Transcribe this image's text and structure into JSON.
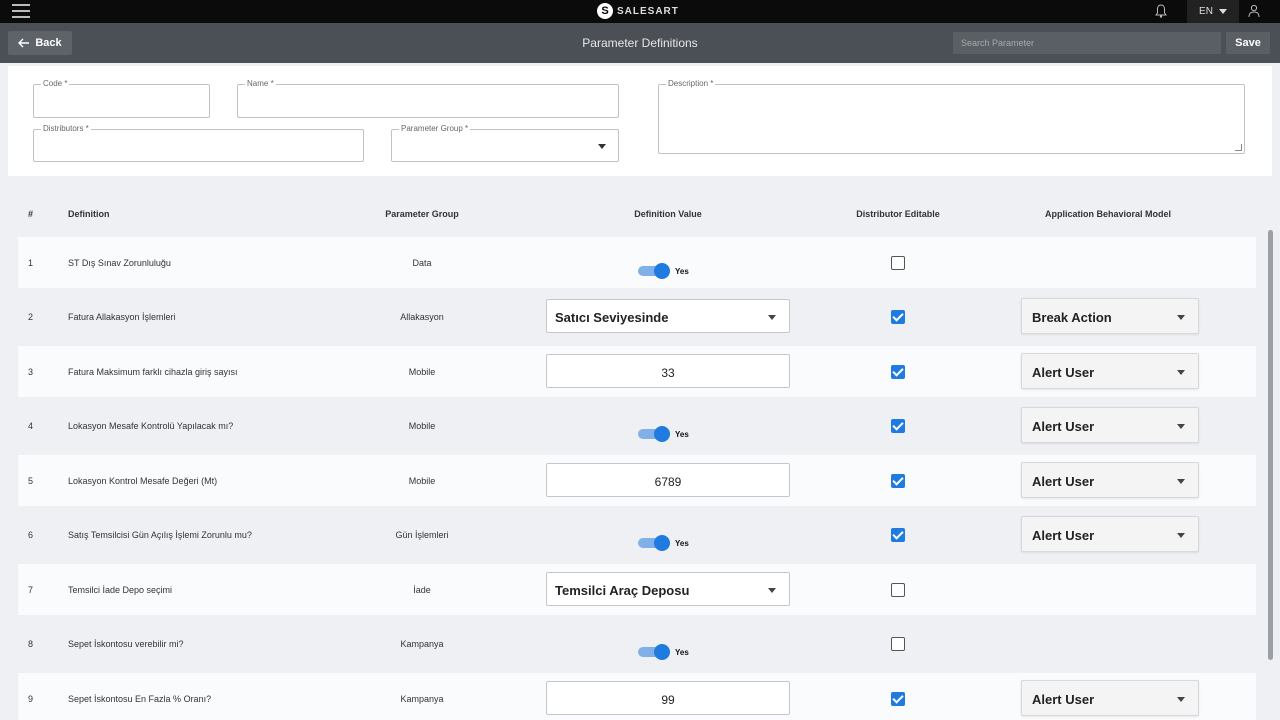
{
  "brand": {
    "name": "SALESART",
    "mark": "S"
  },
  "topbar": {
    "language": "EN"
  },
  "header": {
    "back_label": "Back",
    "title": "Parameter Definitions",
    "search_placeholder": "Search Parameter",
    "save_label": "Save"
  },
  "form": {
    "code_label": "Code *",
    "name_label": "Name *",
    "description_label": "Description *",
    "distributors_label": "Distributors *",
    "parameter_group_label": "Parameter Group *"
  },
  "table": {
    "columns": {
      "num": "#",
      "definition": "Definition",
      "group": "Parameter Group",
      "value": "Definition Value",
      "editable": "Distributor Editable",
      "behavior": "Application Behavioral Model"
    },
    "rows": [
      {
        "num": "1",
        "definition": "ST Dış Sınav Zorunluluğu",
        "group": "Data",
        "value_type": "toggle",
        "value": "Yes",
        "editable": false,
        "behavior": ""
      },
      {
        "num": "2",
        "definition": "Fatura Allakasyon İşlemleri",
        "group": "Allakasyon",
        "value_type": "select",
        "value": "Satıcı Seviyesinde",
        "editable": true,
        "behavior": "Break Action"
      },
      {
        "num": "3",
        "definition": "Fatura Maksimum farklı cihazla giriş sayısı",
        "group": "Mobile",
        "value_type": "number",
        "value": "33",
        "editable": true,
        "behavior": "Alert User"
      },
      {
        "num": "4",
        "definition": "Lokasyon Mesafe Kontrolü Yapılacak mı?",
        "group": "Mobile",
        "value_type": "toggle",
        "value": "Yes",
        "editable": true,
        "behavior": "Alert User"
      },
      {
        "num": "5",
        "definition": "Lokasyon Kontrol Mesafe Değeri (Mt)",
        "group": "Mobile",
        "value_type": "number",
        "value": "6789",
        "editable": true,
        "behavior": "Alert User"
      },
      {
        "num": "6",
        "definition": "Satış Temsilcisi Gün Açılış İşlemi Zorunlu mu?",
        "group": "Gün İşlemleri",
        "value_type": "toggle",
        "value": "Yes",
        "editable": true,
        "behavior": "Alert User"
      },
      {
        "num": "7",
        "definition": "Temsilci İade Depo seçimi",
        "group": "İade",
        "value_type": "select",
        "value": "Temsilci Araç Deposu",
        "editable": false,
        "behavior": ""
      },
      {
        "num": "8",
        "definition": "Sepet İskontosu verebilir mi?",
        "group": "Kampanya",
        "value_type": "toggle",
        "value": "Yes",
        "editable": false,
        "behavior": ""
      },
      {
        "num": "9",
        "definition": "Sepet İskontosu En Fazla % Oranı?",
        "group": "Kampanya",
        "value_type": "number",
        "value": "99",
        "editable": true,
        "behavior": "Alert User"
      }
    ]
  },
  "colors": {
    "accent": "#1f7be0",
    "topbar": "#0b0b0b",
    "subbar": "#4b4f56"
  }
}
